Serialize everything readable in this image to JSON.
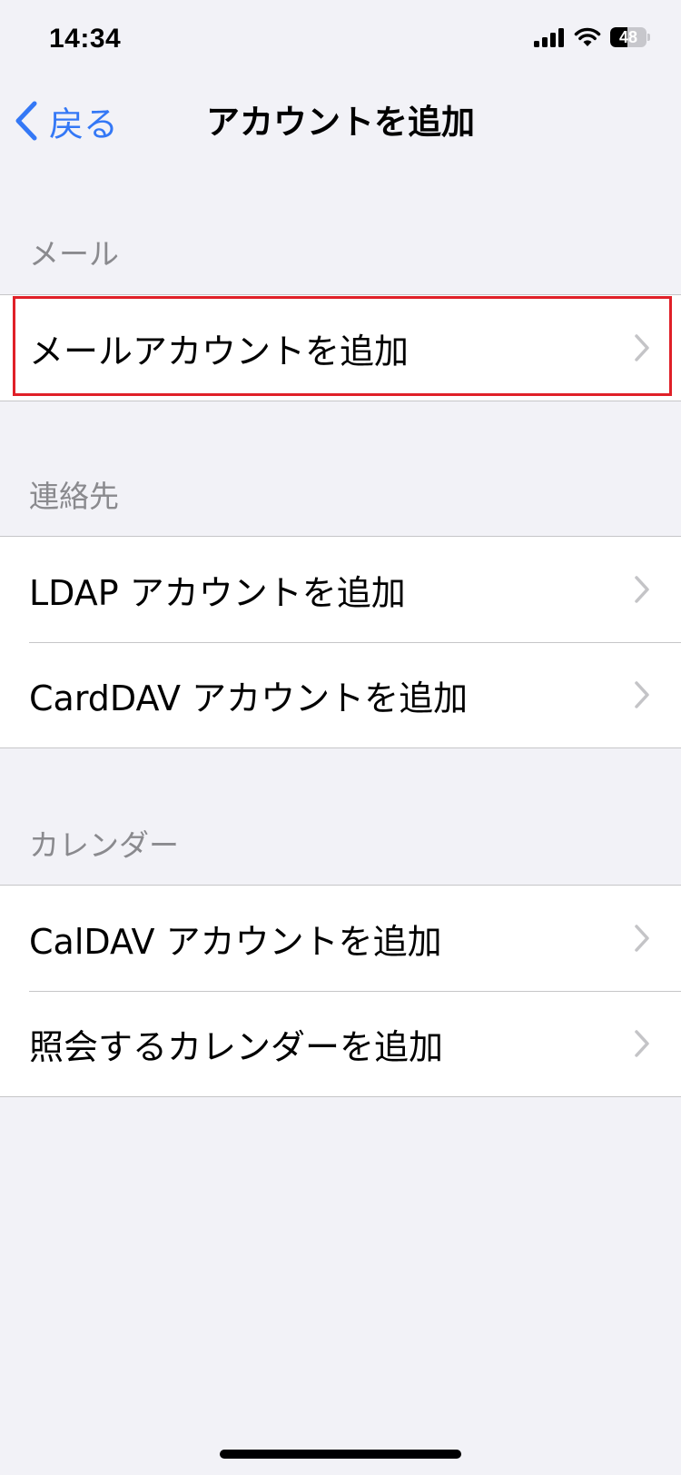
{
  "status_bar": {
    "time": "14:34",
    "battery_level": "48"
  },
  "nav": {
    "back_label": "戻る",
    "title": "アカウントを追加"
  },
  "sections": [
    {
      "header": "メール",
      "items": [
        {
          "label": "メールアカウントを追加",
          "highlighted": true
        }
      ]
    },
    {
      "header": "連絡先",
      "items": [
        {
          "label": "LDAP アカウントを追加"
        },
        {
          "label": "CardDAV アカウントを追加"
        }
      ]
    },
    {
      "header": "カレンダー",
      "items": [
        {
          "label": "CalDAV アカウントを追加"
        },
        {
          "label": "照会するカレンダーを追加"
        }
      ]
    }
  ],
  "colors": {
    "accent": "#3478f6",
    "highlight": "#e02028",
    "background": "#f2f2f7"
  }
}
